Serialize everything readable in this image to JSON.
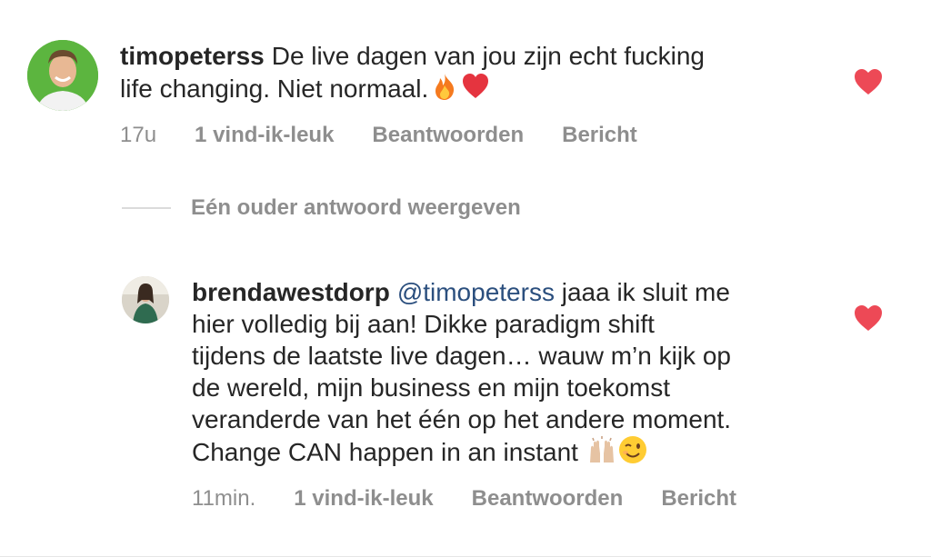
{
  "comments": [
    {
      "username": "timopeterss",
      "text": "De live dagen van jou zijn echt fucking\nlife changing. Niet normaal.",
      "emojis": [
        "fire-emoji",
        "red-heart-emoji"
      ],
      "time": "17u",
      "likes": "1 vind-ik-leuk",
      "reply_label": "Beantwoorden",
      "message_label": "Bericht",
      "liked": true
    },
    {
      "username": "brendawestdorp",
      "mention": "@timopeterss",
      "text": " jaaa ik sluit me\nhier volledig bij aan! Dikke paradigm shift\ntijdens de laatste live dagen… wauw m’n kijk op\nde wereld, mijn business en mijn toekomst\nveranderde van het één op het andere moment.\nChange CAN happen in an instant",
      "emojis": [
        "raising-hands-emoji",
        "winking-face-emoji"
      ],
      "time": "11min.",
      "likes": "1 vind-ik-leuk",
      "reply_label": "Beantwoorden",
      "message_label": "Bericht",
      "liked": true
    }
  ],
  "view_replies_label": "Eén ouder antwoord weergeven",
  "colors": {
    "heart": "#ed4956",
    "mention": "#2b4f7e",
    "meta": "#8e8e8e",
    "avatar_bg": "#5cb53f"
  }
}
